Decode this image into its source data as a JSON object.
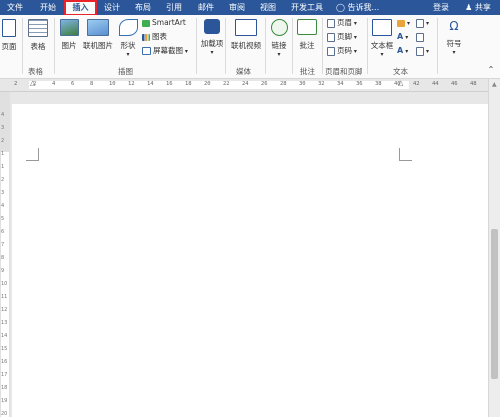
{
  "tabs": {
    "file": "文件",
    "home": "开始",
    "insert": "插入",
    "design": "设计",
    "layout": "布局",
    "references": "引用",
    "mailings": "邮件",
    "review": "审阅",
    "view": "视图",
    "developer": "开发工具",
    "tell_me": "告诉我...",
    "login": "登录",
    "share": "共享"
  },
  "ribbon": {
    "pages": "页面",
    "table": "表格",
    "picture": "图片",
    "online_picture": "联机图片",
    "shapes": "形状",
    "smartart": "SmartArt",
    "chart": "图表",
    "screenshot": "屏幕截图",
    "addins": "加载项",
    "online_video": "联机视频",
    "link": "链接",
    "comment": "批注",
    "header": "页眉",
    "footer": "页脚",
    "page_number": "页码",
    "textbox": "文本框",
    "symbol": "符号",
    "omega": "Ω",
    "letter_a": "A",
    "groups": {
      "tables": "表格",
      "illustrations": "插图",
      "media": "媒体",
      "comments": "批注",
      "header_footer": "页眉和页脚",
      "text": "文本"
    }
  },
  "ruler": {
    "hticks": [
      "2",
      "2",
      "4",
      "6",
      "8",
      "10",
      "12",
      "14",
      "16",
      "18",
      "20",
      "22",
      "24",
      "26",
      "28",
      "30",
      "32",
      "34",
      "36",
      "38",
      "40",
      "42",
      "44",
      "46",
      "48"
    ],
    "vticks": [
      "4",
      "3",
      "2",
      "1",
      "1",
      "2",
      "3",
      "4",
      "5",
      "6",
      "7",
      "8",
      "9",
      "10",
      "11",
      "12",
      "13",
      "14",
      "15",
      "16",
      "17",
      "18",
      "19",
      "20"
    ]
  },
  "colors": {
    "accent": "#2b579a",
    "highlight": "#e8242a",
    "page": "#ffffff",
    "background": "#e7e7e7"
  }
}
